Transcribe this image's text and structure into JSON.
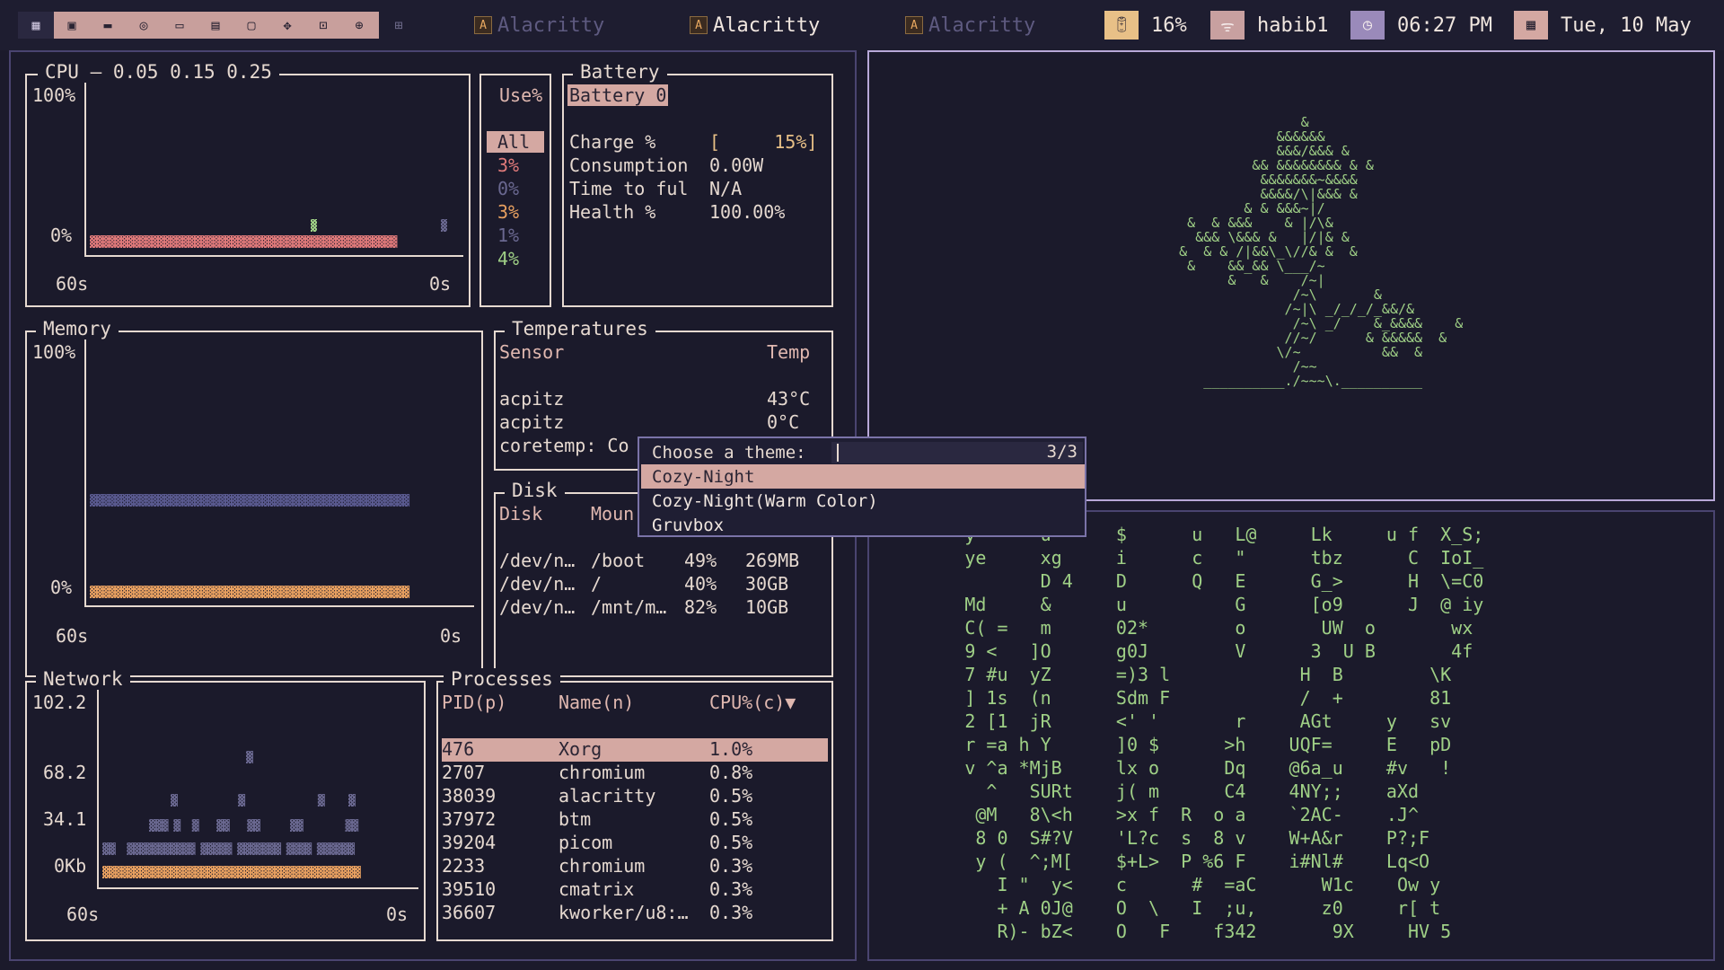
{
  "topbar": {
    "workspace_icons": [
      "grid-icon",
      "terminal-icon",
      "folder-icon",
      "browser-icon",
      "stack-icon",
      "book-icon",
      "chat-icon",
      "plus-icon",
      "settings-icon",
      "apps-icon",
      "grid2-icon"
    ],
    "windows": [
      {
        "title": "Alacritty",
        "active": false
      },
      {
        "title": "Alacritty",
        "active": true
      },
      {
        "title": "Alacritty",
        "active": false
      }
    ],
    "battery": "16%",
    "wifi": "habib1",
    "time": "06:27 PM",
    "date": "Tue, 10 May",
    "colors": {
      "battery_pill": "#e8c087",
      "wifi_pill": "#c8a0a0",
      "clock_pill": "#9a8aba",
      "date_pill": "#d4a8a2",
      "accent": "#d4a8a2"
    }
  },
  "cpu": {
    "title": "CPU — 0.05 0.15 0.25",
    "y_top": "100%",
    "y_bottom": "0%",
    "x_left": "60s",
    "x_right": "0s",
    "legend_header": "Use%",
    "legend": [
      {
        "label": "All",
        "color": "#e6d9d0",
        "selected": true
      },
      {
        "label": "3%",
        "color": "#e07a7a"
      },
      {
        "label": "0%",
        "color": "#6a6890"
      },
      {
        "label": "3%",
        "color": "#e8a060"
      },
      {
        "label": "1%",
        "color": "#6a6890"
      },
      {
        "label": "4%",
        "color": "#9fd086"
      }
    ]
  },
  "battery_widget": {
    "title": "Battery",
    "tab": "Battery 0",
    "rows": [
      {
        "label": "Charge %",
        "value": "[     15%]"
      },
      {
        "label": "Consumption",
        "value": "0.00W"
      },
      {
        "label": "Time to ful",
        "value": "N/A"
      },
      {
        "label": "Health %",
        "value": "100.00%"
      }
    ]
  },
  "memory": {
    "title": "Memory",
    "y_top": "100%",
    "y_bottom": "0%",
    "x_left": "60s",
    "x_right": "0s"
  },
  "temperatures": {
    "title": "Temperatures",
    "col_sensor": "Sensor",
    "col_temp": "Temp",
    "rows": [
      {
        "sensor": "acpitz",
        "temp": "43°C"
      },
      {
        "sensor": "acpitz",
        "temp": "0°C"
      },
      {
        "sensor": "coretemp: Co",
        "temp": ""
      }
    ]
  },
  "disk": {
    "title": "Disk",
    "col_disk": "Disk",
    "col_mount": "Moun",
    "rows": [
      {
        "disk": "/dev/n…",
        "mount": "/boot",
        "pct": "49%",
        "size": "269MB"
      },
      {
        "disk": "/dev/n…",
        "mount": "/",
        "pct": "40%",
        "size": "30GB"
      },
      {
        "disk": "/dev/n…",
        "mount": "/mnt/m…",
        "pct": "82%",
        "size": "10GB"
      }
    ]
  },
  "network": {
    "title": "Network",
    "y_labels": [
      "102.2",
      "68.2",
      "34.1",
      "0Kb"
    ],
    "x_left": "60s",
    "x_right": "0s"
  },
  "processes": {
    "title": "Processes",
    "col_pid": "PID(p)",
    "col_name": "Name(n)",
    "col_cpu": "CPU%(c)▼",
    "rows": [
      {
        "pid": "476",
        "name": "Xorg",
        "cpu": "1.0%",
        "selected": true
      },
      {
        "pid": "2707",
        "name": "chromium",
        "cpu": "0.8%"
      },
      {
        "pid": "38039",
        "name": "alacritty",
        "cpu": "0.5%"
      },
      {
        "pid": "37972",
        "name": "btm",
        "cpu": "0.5%"
      },
      {
        "pid": "39204",
        "name": "picom",
        "cpu": "0.5%"
      },
      {
        "pid": "2233",
        "name": "chromium",
        "cpu": "0.3%"
      },
      {
        "pid": "39510",
        "name": "cmatrix",
        "cpu": "0.3%"
      },
      {
        "pid": "36607",
        "name": "kworker/u8:…",
        "cpu": "0.3%"
      }
    ]
  },
  "theme_picker": {
    "prompt": "Choose a theme:",
    "value": "",
    "counter": "3/3",
    "options": [
      {
        "label": "Cozy-Night",
        "selected": true
      },
      {
        "label": "Cozy-Night(Warm Color)",
        "selected": false
      },
      {
        "label": "Gruvbox",
        "selected": false
      }
    ]
  },
  "bonsai": {
    "lines": [
      "                    &",
      "                 &&&&&&",
      "                 &&&/&&& &",
      "              && &&&&&&&& & &",
      "               &&&&&&&~&&&&",
      "               &&&&/\\|&&& &",
      "             & & &&&~|/",
      "      &  & &&&    & |/\\&",
      "       &&& \\&&& &   |/|& &",
      "     &  & & /|&&\\_\\//& &  &",
      "      &    &&_&& \\___/~",
      "           &   &    /~|",
      "                   /~\\       &",
      "                  /~|\\ _/_/_/_&&/&",
      "                   /~\\ _/    &_&&&&    &",
      "                  //~/      & &&&&&  &",
      "                 \\/~          &&  &",
      "                   /~~",
      "        __________./~~~\\.__________"
    ]
  },
  "matrix": {
    "lines": [
      "        y      u      $      u   L@     Lk     u f  X_S;",
      "        ye     xg     i      c   \"      tbz      C  IoI_",
      "               D 4    D      Q   E      G_>      H  \\=C0",
      "        Md     &      u          G      [o9      J  @ iy",
      "        C( =   m      02*        o       UW  o       wx",
      "        9 <   ]O      g0J        V      3  U B       4f",
      "        7 #u  yZ      =)3 l            H  B        \\K",
      "        ] 1s  (n      Sdm F            /  +        81",
      "        2 [1  jR      <' '       r     AGt     y   sv",
      "        r =a h Y      ]0 $      >h    UQF=     E   pD",
      "        v ^a *MjB     lx o      Dq    @6a_u    #v   !",
      "          ^   SURt    j( m      C4    4NY;;    aXd",
      "         @M   8\\<h    >x f  R  o a    `2AC-    .J^",
      "         8 0  S#?V    'L?c  s  8 v    W+A&r    P?;F",
      "         y (  ^;M[    $+L>  P %6 F    i#Nl#    Lq<O",
      "           I \"  y<    c      #  =aC      W1c    Ow y",
      "           + A 0J@    O  \\   I  ;u,      z0     r[ t",
      "           R)- bZ<    O   F    f342       9X     HV 5"
    ]
  }
}
